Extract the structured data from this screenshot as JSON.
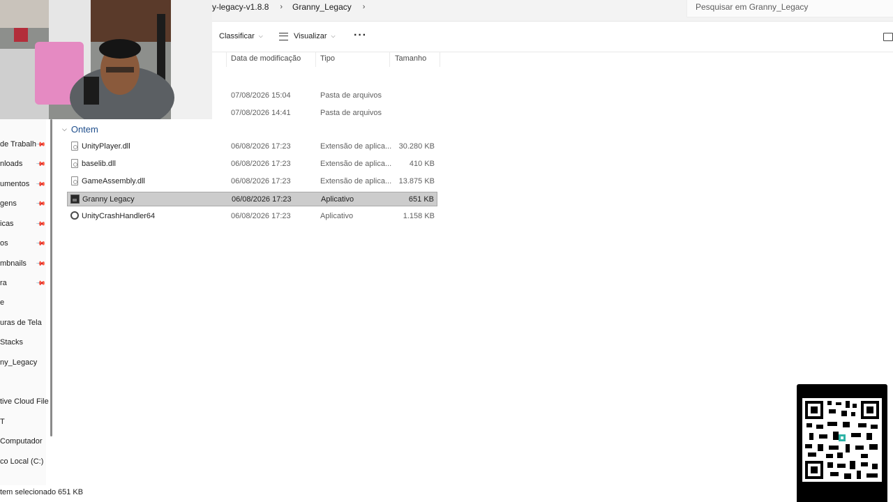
{
  "address": {
    "crumbs": [
      "y-legacy-v1.8.8",
      "Granny_Legacy"
    ],
    "search_placeholder": "Pesquisar em Granny_Legacy"
  },
  "toolbar": {
    "sort_label": "Classificar",
    "view_label": "Visualizar",
    "more_label": "···"
  },
  "columns": {
    "date": "Data de modificação",
    "type": "Tipo",
    "size": "Tamanho"
  },
  "sidebar": {
    "items": [
      {
        "label": "de Trabalh",
        "pinned": true
      },
      {
        "label": "nloads",
        "pinned": true
      },
      {
        "label": "umentos",
        "pinned": true
      },
      {
        "label": "gens",
        "pinned": true
      },
      {
        "label": "icas",
        "pinned": true
      },
      {
        "label": "os",
        "pinned": true
      },
      {
        "label": "mbnails",
        "pinned": true
      },
      {
        "label": "ra",
        "pinned": true
      },
      {
        "label": "e",
        "pinned": false
      },
      {
        "label": "uras de Tela",
        "pinned": false
      },
      {
        "label": "Stacks",
        "pinned": false
      },
      {
        "label": "ny_Legacy",
        "pinned": false
      },
      {
        "label": "tive Cloud File",
        "pinned": false
      },
      {
        "label": "T",
        "pinned": false
      },
      {
        "label": "Computador",
        "pinned": false
      },
      {
        "label": "co Local (C:)",
        "pinned": false
      }
    ]
  },
  "partial_rows": [
    {
      "date": "07/08/2026 15:04",
      "type": "Pasta de arquivos"
    },
    {
      "date": "07/08/2026 14:41",
      "type": "Pasta de arquivos"
    }
  ],
  "group": {
    "label": "Ontem"
  },
  "files": [
    {
      "name": "UnityPlayer.dll",
      "date": "06/08/2026 17:23",
      "type": "Extensão de aplica...",
      "size": "30.280 KB",
      "icon": "dll-file-icon",
      "selected": false
    },
    {
      "name": "baselib.dll",
      "date": "06/08/2026 17:23",
      "type": "Extensão de aplica...",
      "size": "410 KB",
      "icon": "dll-file-icon",
      "selected": false
    },
    {
      "name": "GameAssembly.dll",
      "date": "06/08/2026 17:23",
      "type": "Extensão de aplica...",
      "size": "13.875 KB",
      "icon": "dll-file-icon",
      "selected": false
    },
    {
      "name": "Granny Legacy",
      "date": "06/08/2026 17:23",
      "type": "Aplicativo",
      "size": "651 KB",
      "icon": "app-icon",
      "selected": true
    },
    {
      "name": "UnityCrashHandler64",
      "date": "06/08/2026 17:23",
      "type": "Aplicativo",
      "size": "1.158 KB",
      "icon": "unity-icon",
      "selected": false
    }
  ],
  "status": {
    "selected_text": "tem selecionado",
    "selected_size": "651 KB"
  }
}
